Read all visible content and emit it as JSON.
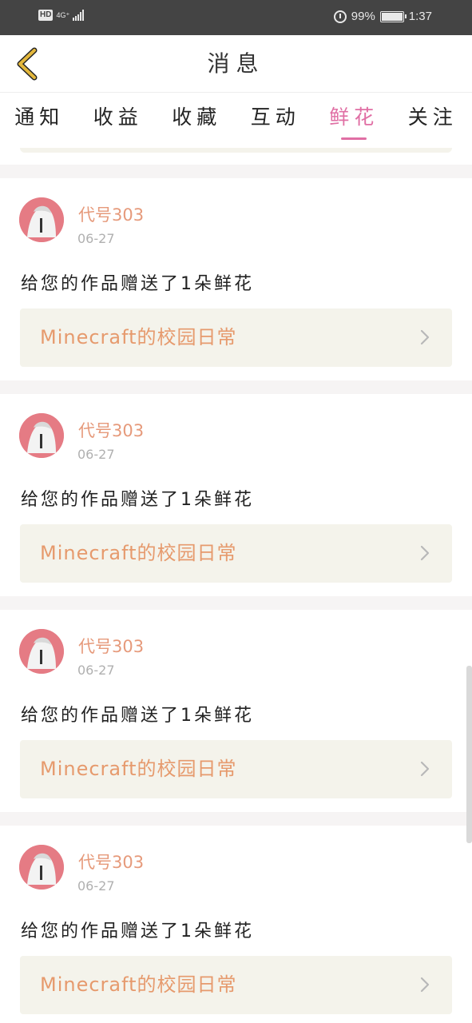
{
  "status_bar": {
    "hd": "HD",
    "network": "4G⁺",
    "battery": "99%",
    "time": "1:37"
  },
  "header": {
    "title": "消息"
  },
  "tabs": [
    {
      "label": "通知"
    },
    {
      "label": "收益"
    },
    {
      "label": "收藏"
    },
    {
      "label": "互动"
    },
    {
      "label": "鲜花",
      "active": true
    },
    {
      "label": "关注"
    }
  ],
  "messages": [
    {
      "sender": "代号303",
      "date": "06-27",
      "text": "给您的作品赠送了1朵鲜花",
      "work_title": "Minecraft的校园日常"
    },
    {
      "sender": "代号303",
      "date": "06-27",
      "text": "给您的作品赠送了1朵鲜花",
      "work_title": "Minecraft的校园日常"
    },
    {
      "sender": "代号303",
      "date": "06-27",
      "text": "给您的作品赠送了1朵鲜花",
      "work_title": "Minecraft的校园日常"
    },
    {
      "sender": "代号303",
      "date": "06-27",
      "text": "给您的作品赠送了1朵鲜花",
      "work_title": "Minecraft的校园日常"
    }
  ],
  "colors": {
    "accent": "#e06fa4",
    "sender": "#e69a7b",
    "work_title": "#e69a6d",
    "back_icon": "#e3b73c",
    "card_bg": "#f4f3eb"
  },
  "icons": {
    "back": "chevron-left-icon",
    "card_arrow": "chevron-right-icon"
  }
}
